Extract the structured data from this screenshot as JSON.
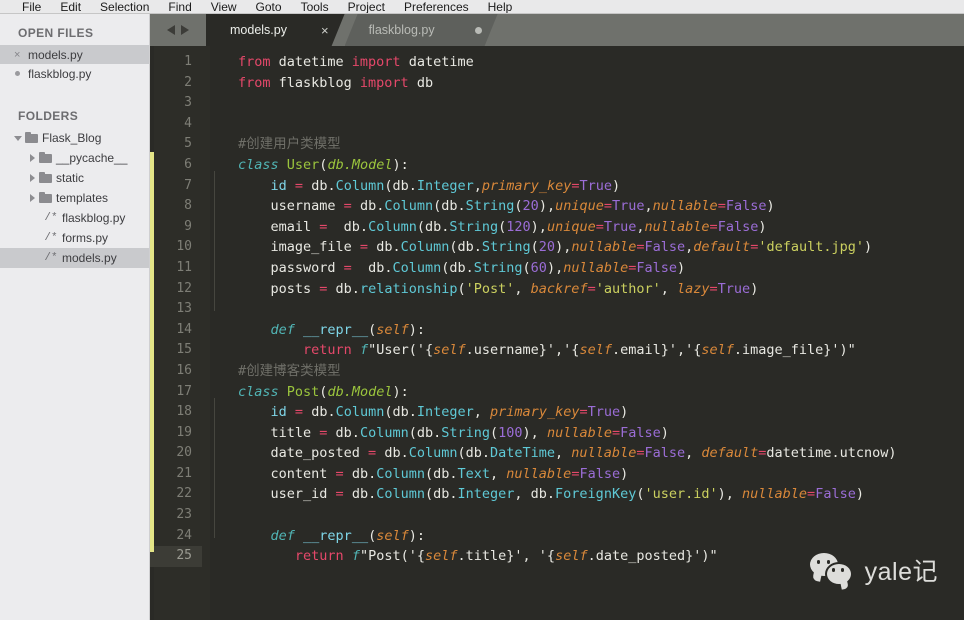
{
  "menubar": {
    "items": [
      "File",
      "Edit",
      "Selection",
      "Find",
      "View",
      "Goto",
      "Tools",
      "Project",
      "Preferences",
      "Help"
    ]
  },
  "sidebar": {
    "open_files": {
      "title": "OPEN FILES",
      "items": [
        {
          "label": "models.py",
          "mark": "×",
          "selected": true
        },
        {
          "label": "flaskblog.py",
          "mark": "dot",
          "selected": false
        }
      ]
    },
    "folders": {
      "title": "FOLDERS",
      "tree": [
        {
          "label": "Flask_Blog",
          "type": "folder",
          "arrow": "down",
          "indent": 0,
          "selected": false
        },
        {
          "label": "__pycache__",
          "type": "folder",
          "arrow": "right",
          "indent": 1,
          "selected": false
        },
        {
          "label": "static",
          "type": "folder",
          "arrow": "right",
          "indent": 1,
          "selected": false
        },
        {
          "label": "templates",
          "type": "folder",
          "arrow": "right",
          "indent": 1,
          "selected": false
        },
        {
          "label": "flaskblog.py",
          "type": "file",
          "icon": "/*",
          "indent": 2,
          "selected": false
        },
        {
          "label": "forms.py",
          "type": "file",
          "icon": "/*",
          "indent": 2,
          "selected": false
        },
        {
          "label": "models.py",
          "type": "file",
          "icon": "/*",
          "indent": 2,
          "selected": true
        }
      ]
    }
  },
  "tabs": [
    {
      "label": "models.py",
      "active": true,
      "close": "×"
    },
    {
      "label": "flaskblog.py",
      "active": false,
      "modified": true
    }
  ],
  "editor": {
    "current_line": 25,
    "line_numbers": [
      1,
      2,
      3,
      4,
      5,
      6,
      7,
      8,
      9,
      10,
      11,
      12,
      13,
      14,
      15,
      16,
      17,
      18,
      19,
      20,
      21,
      22,
      23,
      24,
      25
    ],
    "code_lines": [
      [
        {
          "t": "from",
          "c": "kw"
        },
        {
          "t": " datetime ",
          "c": "pl"
        },
        {
          "t": "import",
          "c": "kw"
        },
        {
          "t": " datetime",
          "c": "pl"
        }
      ],
      [
        {
          "t": "from",
          "c": "kw"
        },
        {
          "t": " flaskblog ",
          "c": "pl"
        },
        {
          "t": "import",
          "c": "kw"
        },
        {
          "t": " db",
          "c": "pl"
        }
      ],
      [],
      [],
      [
        {
          "t": "#创建用户类模型",
          "c": "cmt"
        }
      ],
      [
        {
          "t": "class",
          "c": "kw2"
        },
        {
          "t": " ",
          "c": "pl"
        },
        {
          "t": "User",
          "c": "cls"
        },
        {
          "t": "(",
          "c": "pl"
        },
        {
          "t": "db.Model",
          "c": "clsi"
        },
        {
          "t": "):",
          "c": "pl"
        }
      ],
      [
        {
          "t": "    ",
          "c": "pl"
        },
        {
          "t": "id",
          "c": "def"
        },
        {
          "t": " ",
          "c": "pl"
        },
        {
          "t": "=",
          "c": "op"
        },
        {
          "t": " db.",
          "c": "pl"
        },
        {
          "t": "Column",
          "c": "fn"
        },
        {
          "t": "(db.",
          "c": "pl"
        },
        {
          "t": "Integer",
          "c": "fn"
        },
        {
          "t": ",",
          "c": "pl"
        },
        {
          "t": "primary_key",
          "c": "param"
        },
        {
          "t": "=",
          "c": "op"
        },
        {
          "t": "True",
          "c": "bool"
        },
        {
          "t": ")",
          "c": "pl"
        }
      ],
      [
        {
          "t": "    username ",
          "c": "pl"
        },
        {
          "t": "=",
          "c": "op"
        },
        {
          "t": " db.",
          "c": "pl"
        },
        {
          "t": "Column",
          "c": "fn"
        },
        {
          "t": "(db.",
          "c": "pl"
        },
        {
          "t": "String",
          "c": "fn"
        },
        {
          "t": "(",
          "c": "pl"
        },
        {
          "t": "20",
          "c": "num"
        },
        {
          "t": "),",
          "c": "pl"
        },
        {
          "t": "unique",
          "c": "param"
        },
        {
          "t": "=",
          "c": "op"
        },
        {
          "t": "True",
          "c": "bool"
        },
        {
          "t": ",",
          "c": "pl"
        },
        {
          "t": "nullable",
          "c": "param"
        },
        {
          "t": "=",
          "c": "op"
        },
        {
          "t": "False",
          "c": "bool"
        },
        {
          "t": ")",
          "c": "pl"
        }
      ],
      [
        {
          "t": "    email ",
          "c": "pl"
        },
        {
          "t": "=",
          "c": "op"
        },
        {
          "t": "  db.",
          "c": "pl"
        },
        {
          "t": "Column",
          "c": "fn"
        },
        {
          "t": "(db.",
          "c": "pl"
        },
        {
          "t": "String",
          "c": "fn"
        },
        {
          "t": "(",
          "c": "pl"
        },
        {
          "t": "120",
          "c": "num"
        },
        {
          "t": "),",
          "c": "pl"
        },
        {
          "t": "unique",
          "c": "param"
        },
        {
          "t": "=",
          "c": "op"
        },
        {
          "t": "True",
          "c": "bool"
        },
        {
          "t": ",",
          "c": "pl"
        },
        {
          "t": "nullable",
          "c": "param"
        },
        {
          "t": "=",
          "c": "op"
        },
        {
          "t": "False",
          "c": "bool"
        },
        {
          "t": ")",
          "c": "pl"
        }
      ],
      [
        {
          "t": "    image_file ",
          "c": "pl"
        },
        {
          "t": "=",
          "c": "op"
        },
        {
          "t": " db.",
          "c": "pl"
        },
        {
          "t": "Column",
          "c": "fn"
        },
        {
          "t": "(db.",
          "c": "pl"
        },
        {
          "t": "String",
          "c": "fn"
        },
        {
          "t": "(",
          "c": "pl"
        },
        {
          "t": "20",
          "c": "num"
        },
        {
          "t": "),",
          "c": "pl"
        },
        {
          "t": "nullable",
          "c": "param"
        },
        {
          "t": "=",
          "c": "op"
        },
        {
          "t": "False",
          "c": "bool"
        },
        {
          "t": ",",
          "c": "pl"
        },
        {
          "t": "default",
          "c": "param"
        },
        {
          "t": "=",
          "c": "op"
        },
        {
          "t": "'default.jpg'",
          "c": "str"
        },
        {
          "t": ")",
          "c": "pl"
        }
      ],
      [
        {
          "t": "    password ",
          "c": "pl"
        },
        {
          "t": "=",
          "c": "op"
        },
        {
          "t": "  db.",
          "c": "pl"
        },
        {
          "t": "Column",
          "c": "fn"
        },
        {
          "t": "(db.",
          "c": "pl"
        },
        {
          "t": "String",
          "c": "fn"
        },
        {
          "t": "(",
          "c": "pl"
        },
        {
          "t": "60",
          "c": "num"
        },
        {
          "t": "),",
          "c": "pl"
        },
        {
          "t": "nullable",
          "c": "param"
        },
        {
          "t": "=",
          "c": "op"
        },
        {
          "t": "False",
          "c": "bool"
        },
        {
          "t": ")",
          "c": "pl"
        }
      ],
      [
        {
          "t": "    posts ",
          "c": "pl"
        },
        {
          "t": "=",
          "c": "op"
        },
        {
          "t": " db.",
          "c": "pl"
        },
        {
          "t": "relationship",
          "c": "fn"
        },
        {
          "t": "(",
          "c": "pl"
        },
        {
          "t": "'Post'",
          "c": "str"
        },
        {
          "t": ", ",
          "c": "pl"
        },
        {
          "t": "backref",
          "c": "param"
        },
        {
          "t": "=",
          "c": "op"
        },
        {
          "t": "'author'",
          "c": "str"
        },
        {
          "t": ", ",
          "c": "pl"
        },
        {
          "t": "lazy",
          "c": "param"
        },
        {
          "t": "=",
          "c": "op"
        },
        {
          "t": "True",
          "c": "bool"
        },
        {
          "t": ")",
          "c": "pl"
        }
      ],
      [],
      [
        {
          "t": "    ",
          "c": "pl"
        },
        {
          "t": "def",
          "c": "kw2"
        },
        {
          "t": " ",
          "c": "pl"
        },
        {
          "t": "__repr__",
          "c": "def"
        },
        {
          "t": "(",
          "c": "pl"
        },
        {
          "t": "self",
          "c": "param"
        },
        {
          "t": "):",
          "c": "pl"
        }
      ],
      [
        {
          "t": "        ",
          "c": "pl"
        },
        {
          "t": "return",
          "c": "kw"
        },
        {
          "t": " ",
          "c": "pl"
        },
        {
          "t": "f",
          "c": "fs"
        },
        {
          "t": "\"User('{",
          "c": "pl"
        },
        {
          "t": "self",
          "c": "param"
        },
        {
          "t": ".username}','{",
          "c": "pl"
        },
        {
          "t": "self",
          "c": "param"
        },
        {
          "t": ".email}','{",
          "c": "pl"
        },
        {
          "t": "self",
          "c": "param"
        },
        {
          "t": ".image_file}')\"",
          "c": "pl"
        }
      ],
      [
        {
          "t": "#创建博客类模型",
          "c": "cmt"
        }
      ],
      [
        {
          "t": "class",
          "c": "kw2"
        },
        {
          "t": " ",
          "c": "pl"
        },
        {
          "t": "Post",
          "c": "cls"
        },
        {
          "t": "(",
          "c": "pl"
        },
        {
          "t": "db.Model",
          "c": "clsi"
        },
        {
          "t": "):",
          "c": "pl"
        }
      ],
      [
        {
          "t": "    ",
          "c": "pl"
        },
        {
          "t": "id",
          "c": "def"
        },
        {
          "t": " ",
          "c": "pl"
        },
        {
          "t": "=",
          "c": "op"
        },
        {
          "t": " db.",
          "c": "pl"
        },
        {
          "t": "Column",
          "c": "fn"
        },
        {
          "t": "(db.",
          "c": "pl"
        },
        {
          "t": "Integer",
          "c": "fn"
        },
        {
          "t": ", ",
          "c": "pl"
        },
        {
          "t": "primary_key",
          "c": "param"
        },
        {
          "t": "=",
          "c": "op"
        },
        {
          "t": "True",
          "c": "bool"
        },
        {
          "t": ")",
          "c": "pl"
        }
      ],
      [
        {
          "t": "    title ",
          "c": "pl"
        },
        {
          "t": "=",
          "c": "op"
        },
        {
          "t": " db.",
          "c": "pl"
        },
        {
          "t": "Column",
          "c": "fn"
        },
        {
          "t": "(db.",
          "c": "pl"
        },
        {
          "t": "String",
          "c": "fn"
        },
        {
          "t": "(",
          "c": "pl"
        },
        {
          "t": "100",
          "c": "num"
        },
        {
          "t": "), ",
          "c": "pl"
        },
        {
          "t": "nullable",
          "c": "param"
        },
        {
          "t": "=",
          "c": "op"
        },
        {
          "t": "False",
          "c": "bool"
        },
        {
          "t": ")",
          "c": "pl"
        }
      ],
      [
        {
          "t": "    date_posted ",
          "c": "pl"
        },
        {
          "t": "=",
          "c": "op"
        },
        {
          "t": " db.",
          "c": "pl"
        },
        {
          "t": "Column",
          "c": "fn"
        },
        {
          "t": "(db.",
          "c": "pl"
        },
        {
          "t": "DateTime",
          "c": "fn"
        },
        {
          "t": ", ",
          "c": "pl"
        },
        {
          "t": "nullable",
          "c": "param"
        },
        {
          "t": "=",
          "c": "op"
        },
        {
          "t": "False",
          "c": "bool"
        },
        {
          "t": ", ",
          "c": "pl"
        },
        {
          "t": "default",
          "c": "param"
        },
        {
          "t": "=",
          "c": "op"
        },
        {
          "t": "datetime.utcnow",
          "c": "pl"
        },
        {
          "t": ")",
          "c": "pl"
        }
      ],
      [
        {
          "t": "    content ",
          "c": "pl"
        },
        {
          "t": "=",
          "c": "op"
        },
        {
          "t": " db.",
          "c": "pl"
        },
        {
          "t": "Column",
          "c": "fn"
        },
        {
          "t": "(db.",
          "c": "pl"
        },
        {
          "t": "Text",
          "c": "fn"
        },
        {
          "t": ", ",
          "c": "pl"
        },
        {
          "t": "nullable",
          "c": "param"
        },
        {
          "t": "=",
          "c": "op"
        },
        {
          "t": "False",
          "c": "bool"
        },
        {
          "t": ")",
          "c": "pl"
        }
      ],
      [
        {
          "t": "    user_id ",
          "c": "pl"
        },
        {
          "t": "=",
          "c": "op"
        },
        {
          "t": " db.",
          "c": "pl"
        },
        {
          "t": "Column",
          "c": "fn"
        },
        {
          "t": "(db.",
          "c": "pl"
        },
        {
          "t": "Integer",
          "c": "fn"
        },
        {
          "t": ", db.",
          "c": "pl"
        },
        {
          "t": "ForeignKey",
          "c": "fn"
        },
        {
          "t": "(",
          "c": "pl"
        },
        {
          "t": "'user.id'",
          "c": "str"
        },
        {
          "t": "), ",
          "c": "pl"
        },
        {
          "t": "nullable",
          "c": "param"
        },
        {
          "t": "=",
          "c": "op"
        },
        {
          "t": "False",
          "c": "bool"
        },
        {
          "t": ")",
          "c": "pl"
        }
      ],
      [],
      [
        {
          "t": "    ",
          "c": "pl"
        },
        {
          "t": "def",
          "c": "kw2"
        },
        {
          "t": " ",
          "c": "pl"
        },
        {
          "t": "__repr__",
          "c": "def"
        },
        {
          "t": "(",
          "c": "pl"
        },
        {
          "t": "self",
          "c": "param"
        },
        {
          "t": "):",
          "c": "pl"
        }
      ],
      [
        {
          "t": "       ",
          "c": "pl"
        },
        {
          "t": "return",
          "c": "kw"
        },
        {
          "t": " ",
          "c": "pl"
        },
        {
          "t": "f",
          "c": "fs"
        },
        {
          "t": "\"Post('{",
          "c": "pl"
        },
        {
          "t": "self",
          "c": "param"
        },
        {
          "t": ".title}', '{",
          "c": "pl"
        },
        {
          "t": "self",
          "c": "param"
        },
        {
          "t": ".date_posted}')\"",
          "c": "pl"
        }
      ]
    ]
  },
  "watermark": {
    "text": "yale记",
    "logo": "wechat-logo"
  },
  "colors": {
    "editor_bg": "#2a2a26",
    "gutter_bg": "#2d2d28",
    "sidebar_bg": "#ececee",
    "tabbar_bg": "#6f716c",
    "accent_yellow": "#e4e587",
    "keyword": "#e5486a",
    "string": "#cbd05f",
    "number": "#9b6dd6",
    "param": "#d9883a",
    "function": "#5fc9d6",
    "classname": "#9bc53d",
    "comment": "#6f6f68"
  }
}
